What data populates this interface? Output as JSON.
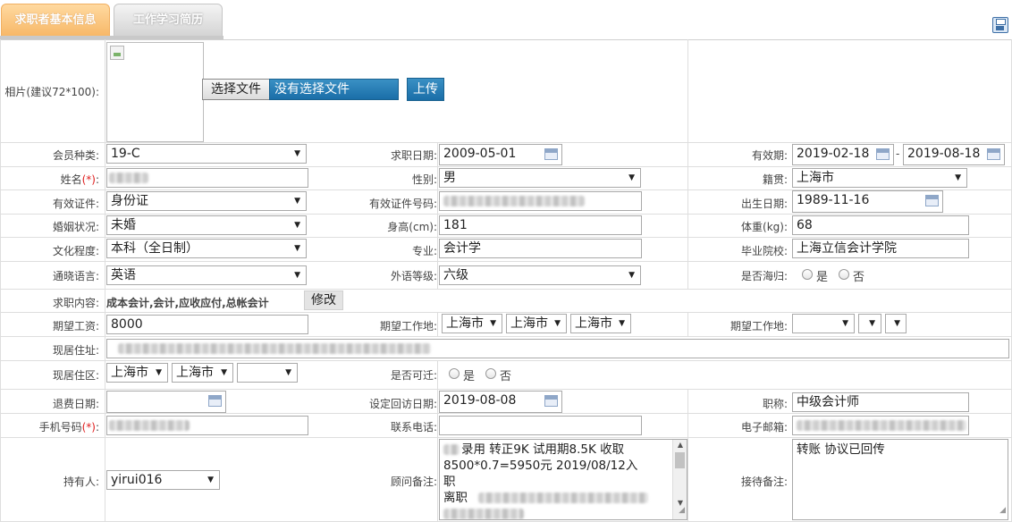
{
  "tabs": {
    "basic": "求职者基本信息",
    "history": "工作学习简历"
  },
  "photo": {
    "label": "相片(建议72*100):",
    "choose_button": "选择文件",
    "no_file": "没有选择文件",
    "upload_button": "上传"
  },
  "labels": {
    "member_type": "会员种类:",
    "apply_date": "求职日期:",
    "valid_period": "有效期:",
    "name": "姓名",
    "gender": "性别:",
    "native_place": "籍贯:",
    "id_type": "有效证件:",
    "id_number": "有效证件号码:",
    "birth_date": "出生日期:",
    "marital": "婚姻状况:",
    "height": "身高(cm):",
    "weight": "体重(kg):",
    "education": "文化程度:",
    "major": "专业:",
    "school": "毕业院校:",
    "language": "通晓语言:",
    "language_level": "外语等级:",
    "returnee": "是否海归:",
    "job_content": "求职内容:",
    "expected_salary": "期望工资:",
    "expected_location": "期望工作地:",
    "expected_location2": "期望工作地:",
    "address": "现居住址:",
    "current_area": "现居住区:",
    "relocate": "是否可迁:",
    "refund_date": "退费日期:",
    "followup_date": "设定回访日期:",
    "title": "职称:",
    "mobile": "手机号码",
    "phone": "联系电话:",
    "email": "电子邮箱:",
    "holder": "持有人:",
    "consultant_note": "顾问备注:",
    "reception_note": "接待备注:",
    "required_mark": "(*)",
    "colon": ":",
    "yes": "是",
    "no": "否",
    "dash": "-"
  },
  "values": {
    "member_type": "19-C",
    "apply_date": "2009-05-01",
    "valid_from": "2019-02-18",
    "valid_to": "2019-08-18",
    "gender": "男",
    "native_place": "上海市",
    "id_type": "身份证",
    "birth_date": "1989-11-16",
    "marital": "未婚",
    "height": "181",
    "weight": "68",
    "education": "本科（全日制）",
    "major": "会计学",
    "school": "上海立信会计学院",
    "language": "英语",
    "language_level": "六级",
    "job_content": "成本会计,会计,应收应付,总帐会计",
    "modify_button": "修改",
    "expected_salary": "8000",
    "exp_loc_1": "上海市",
    "exp_loc_2": "上海市",
    "exp_loc_3": "上海市",
    "area_1": "上海市",
    "area_2": "上海市",
    "followup_date": "2019-08-08",
    "title": "中级会计师",
    "holder": "yirui016",
    "consultant_note_l1": "录用 转正9K 试用期8.5K 收取",
    "consultant_note_l2": "8500*0.7=5950元 2019/08/12入",
    "consultant_note_l3": "职",
    "consultant_note_l4": "离职",
    "reception_note": "转账 协议已回传"
  },
  "colors": {
    "tab_active": "#f7b868",
    "tab_inactive": "#d4d4d4",
    "button_blue": "#1a6ea8",
    "required": "#e02020"
  },
  "icons": [
    "save-icon",
    "calendar-icon",
    "dropdown-arrow-icon",
    "broken-image-icon"
  ]
}
